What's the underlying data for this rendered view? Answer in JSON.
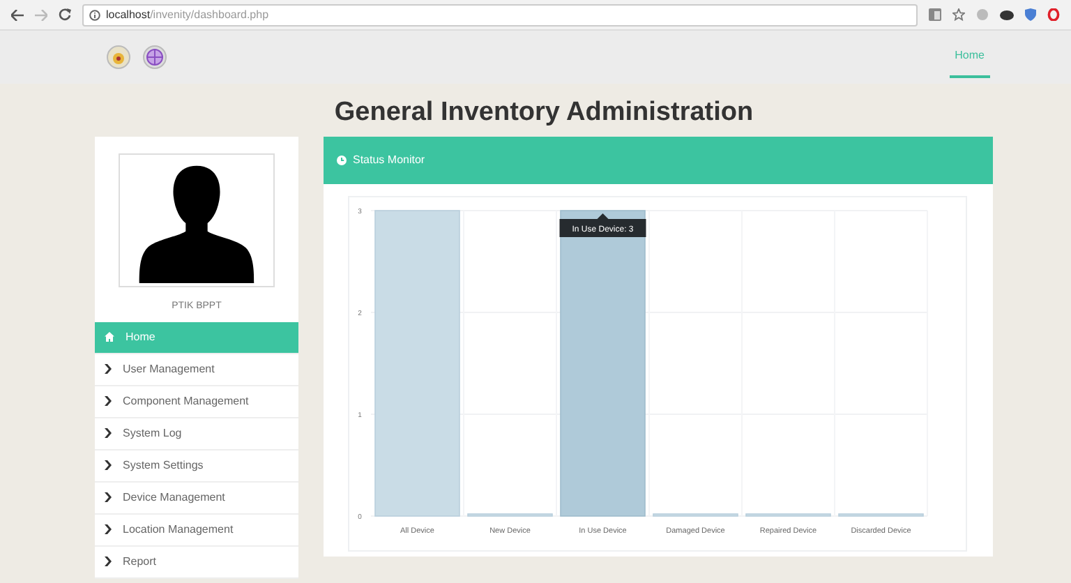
{
  "browser": {
    "url_host": "localhost",
    "url_path": "/invenity/dashboard.php"
  },
  "navbar": {
    "links": [
      {
        "label": "Home",
        "selected": true
      }
    ]
  },
  "page_title": "General Inventory Administration",
  "sidebar": {
    "profile_name": "PTIK BPPT",
    "items": [
      {
        "label": "Home",
        "kind": "home",
        "selected": true
      },
      {
        "label": "User Management",
        "kind": "chevron",
        "selected": false
      },
      {
        "label": "Component Management",
        "kind": "chevron",
        "selected": false
      },
      {
        "label": "System Log",
        "kind": "chevron",
        "selected": false
      },
      {
        "label": "System Settings",
        "kind": "chevron",
        "selected": false
      },
      {
        "label": "Device Management",
        "kind": "chevron",
        "selected": false
      },
      {
        "label": "Location Management",
        "kind": "chevron",
        "selected": false
      },
      {
        "label": "Report",
        "kind": "chevron",
        "selected": false
      }
    ]
  },
  "status_monitor": {
    "title": "Status Monitor",
    "chart_data": {
      "type": "bar",
      "categories": [
        "All Device",
        "New Device",
        "In Use Device",
        "Damaged Device",
        "Repaired Device",
        "Discarded Device"
      ],
      "values": [
        3,
        0,
        3,
        0,
        0,
        0
      ],
      "ylim": [
        0,
        3
      ],
      "yticks": [
        0,
        1,
        2,
        3
      ]
    },
    "bars": [
      {
        "hovered": false
      },
      {
        "hovered": false
      },
      {
        "hovered": true
      },
      {
        "hovered": false
      },
      {
        "hovered": false
      },
      {
        "hovered": false
      }
    ],
    "tooltip": {
      "text": "In Use Device: 3"
    }
  }
}
